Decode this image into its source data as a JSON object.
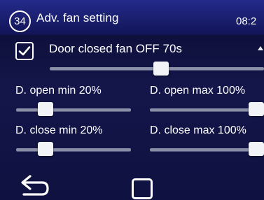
{
  "header": {
    "page_number": "34",
    "title": "Adv. fan setting",
    "clock": "08:2"
  },
  "door_closed_fan": {
    "checked": true,
    "label": "Door closed fan OFF  70s",
    "slider_level_percent": 52
  },
  "sliders": [
    {
      "label": "D. open min 20%",
      "level_percent": 22
    },
    {
      "label": "D. open max 100%",
      "level_percent": 100
    },
    {
      "label": "D. close min 20%",
      "level_percent": 22
    },
    {
      "label": "D. close max 100%",
      "level_percent": 100
    }
  ],
  "nav": {
    "back": "back-arrow-icon",
    "home": "square-home-icon"
  }
}
